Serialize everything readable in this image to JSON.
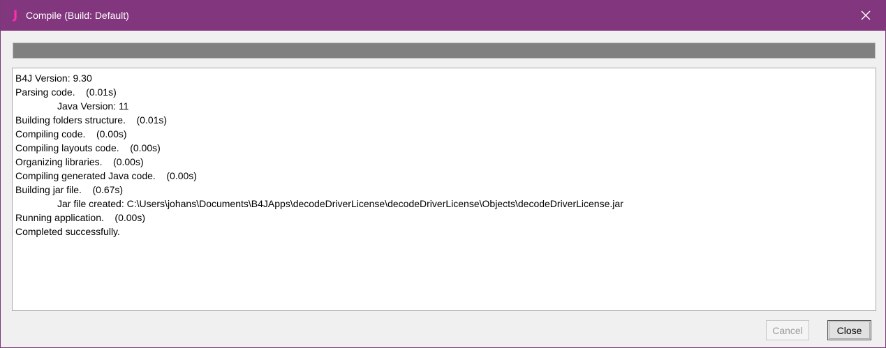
{
  "window": {
    "title": "Compile (Build: Default)",
    "app_icon_glyph": "J",
    "accent_color": "#82367d",
    "icon_color": "#ff2fa8"
  },
  "progress": {
    "value_fraction": 1.0
  },
  "log": {
    "lines": [
      {
        "text": "B4J Version: 9.30",
        "indent": false
      },
      {
        "text": "Parsing code.    (0.01s)",
        "indent": false
      },
      {
        "text": "Java Version: 11",
        "indent": true
      },
      {
        "text": "Building folders structure.    (0.01s)",
        "indent": false
      },
      {
        "text": "Compiling code.    (0.00s)",
        "indent": false
      },
      {
        "text": "Compiling layouts code.    (0.00s)",
        "indent": false
      },
      {
        "text": "Organizing libraries.    (0.00s)",
        "indent": false
      },
      {
        "text": "Compiling generated Java code.    (0.00s)",
        "indent": false
      },
      {
        "text": "Building jar file.    (0.67s)",
        "indent": false
      },
      {
        "text": "Jar file created: C:\\Users\\johans\\Documents\\B4JApps\\decodeDriverLicense\\decodeDriverLicense\\Objects\\decodeDriverLicense.jar",
        "indent": true
      },
      {
        "text": "Running application.    (0.00s)",
        "indent": false
      },
      {
        "text": "Completed successfully.",
        "indent": false
      }
    ]
  },
  "buttons": {
    "cancel_label": "Cancel",
    "cancel_enabled": false,
    "close_label": "Close"
  },
  "icons": {
    "app": "b4j-app-icon",
    "close": "close-icon"
  }
}
